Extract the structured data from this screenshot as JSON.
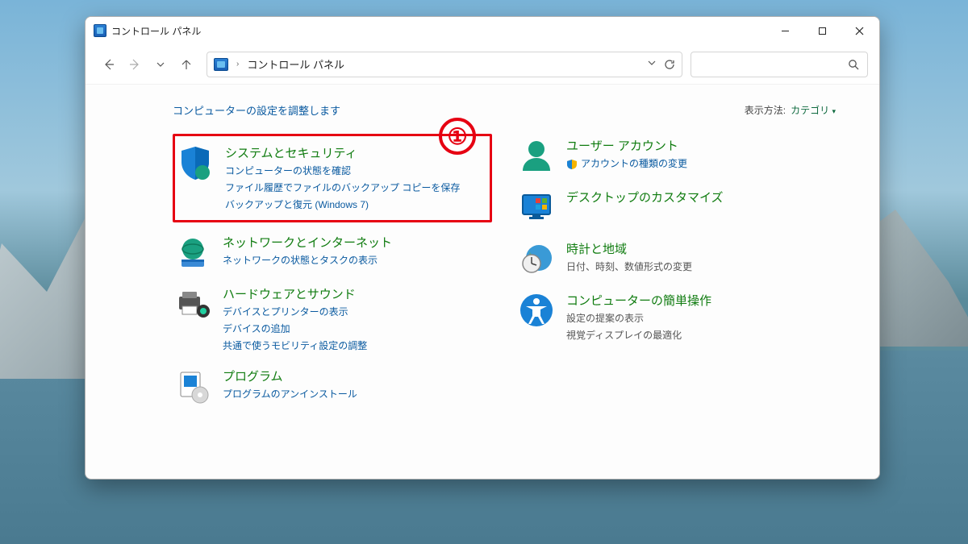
{
  "window": {
    "title": "コントロール パネル"
  },
  "address": {
    "root": "コントロール パネル"
  },
  "content": {
    "heading": "コンピューターの設定を調整します",
    "viewby_label": "表示方法:",
    "viewby_value": "カテゴリ"
  },
  "annotation": {
    "badge": "①"
  },
  "left": [
    {
      "title": "システムとセキュリティ",
      "links": [
        "コンピューターの状態を確認",
        "ファイル履歴でファイルのバックアップ コピーを保存",
        "バックアップと復元 (Windows 7)"
      ]
    },
    {
      "title": "ネットワークとインターネット",
      "links": [
        "ネットワークの状態とタスクの表示"
      ]
    },
    {
      "title": "ハードウェアとサウンド",
      "links": [
        "デバイスとプリンターの表示",
        "デバイスの追加",
        "共通で使うモビリティ設定の調整"
      ]
    },
    {
      "title": "プログラム",
      "links": [
        "プログラムのアンインストール"
      ]
    }
  ],
  "right": [
    {
      "title": "ユーザー アカウント",
      "links": [
        "アカウントの種類の変更"
      ],
      "shield_on_first": true
    },
    {
      "title": "デスクトップのカスタマイズ",
      "links": []
    },
    {
      "title": "時計と地域",
      "links_plain": [
        "日付、時刻、数値形式の変更"
      ]
    },
    {
      "title": "コンピューターの簡単操作",
      "links_plain": [
        "設定の提案の表示",
        "視覚ディスプレイの最適化"
      ]
    }
  ]
}
